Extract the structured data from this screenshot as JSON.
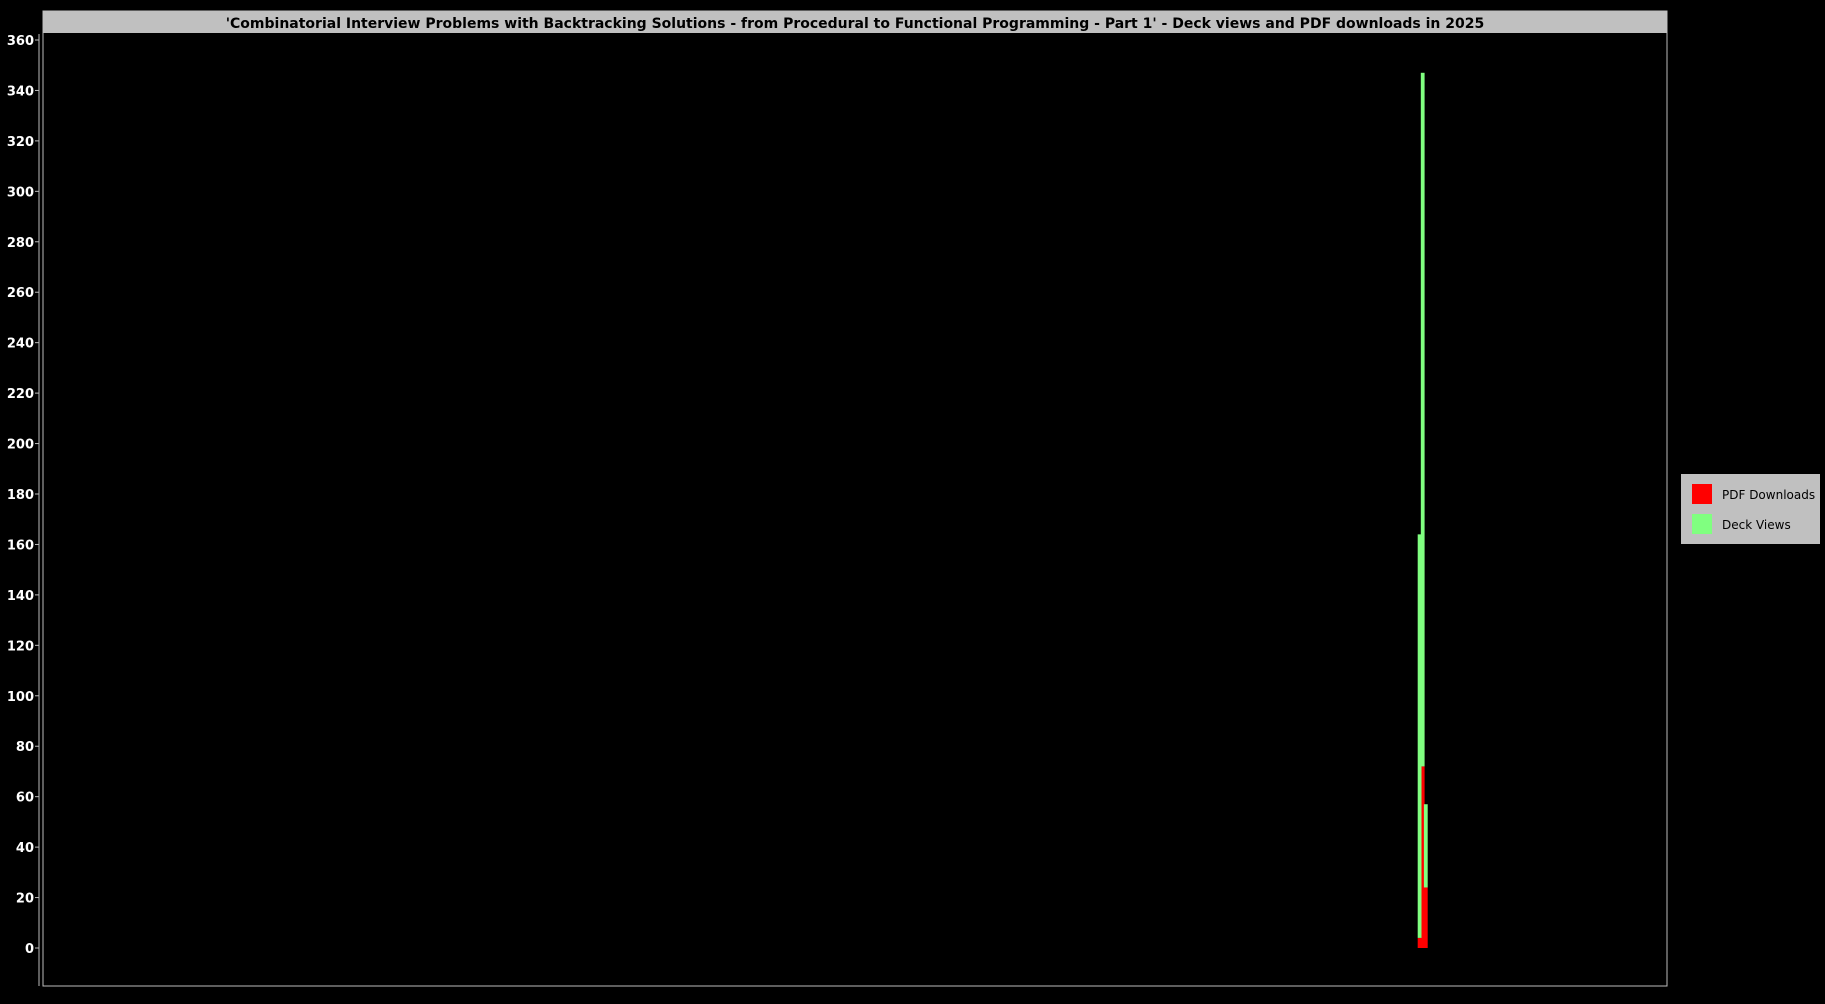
{
  "colors": {
    "background": "#000000",
    "title_bar": "#c0c0c0",
    "title_text": "#000000",
    "plot_border": "#bdbdbd",
    "axis_text": "#ffffff",
    "legend_bg": "#c0c0c0",
    "legend_text": "#000000"
  },
  "chart_data": {
    "type": "bar",
    "stacked": true,
    "title": "'Combinatorial Interview Problems with Backtracking Solutions - from Procedural to Functional Programming - Part 1' - Deck views and PDF downloads in 2025",
    "xlabel": "",
    "ylabel": "",
    "ylim": [
      0,
      360
    ],
    "yticks": [
      0,
      20,
      40,
      60,
      80,
      100,
      120,
      140,
      160,
      180,
      200,
      220,
      240,
      260,
      280,
      300,
      320,
      340,
      360
    ],
    "x_domain_days": 365,
    "x_tick_labels_shown": false,
    "grid": false,
    "legend_position": "right",
    "legend": [
      {
        "name": "PDF Downloads",
        "color": "#ff0000"
      },
      {
        "name": "Deck Views",
        "color": "#80ff80"
      }
    ],
    "series": [
      {
        "name": "PDF Downloads",
        "color": "#ff0000",
        "day_index": [
          310,
          311,
          312
        ],
        "values": [
          4,
          72,
          24
        ]
      },
      {
        "name": "Deck Views",
        "color": "#80ff80",
        "day_index": [
          310,
          311,
          312
        ],
        "values": [
          160,
          275,
          33
        ]
      }
    ]
  }
}
